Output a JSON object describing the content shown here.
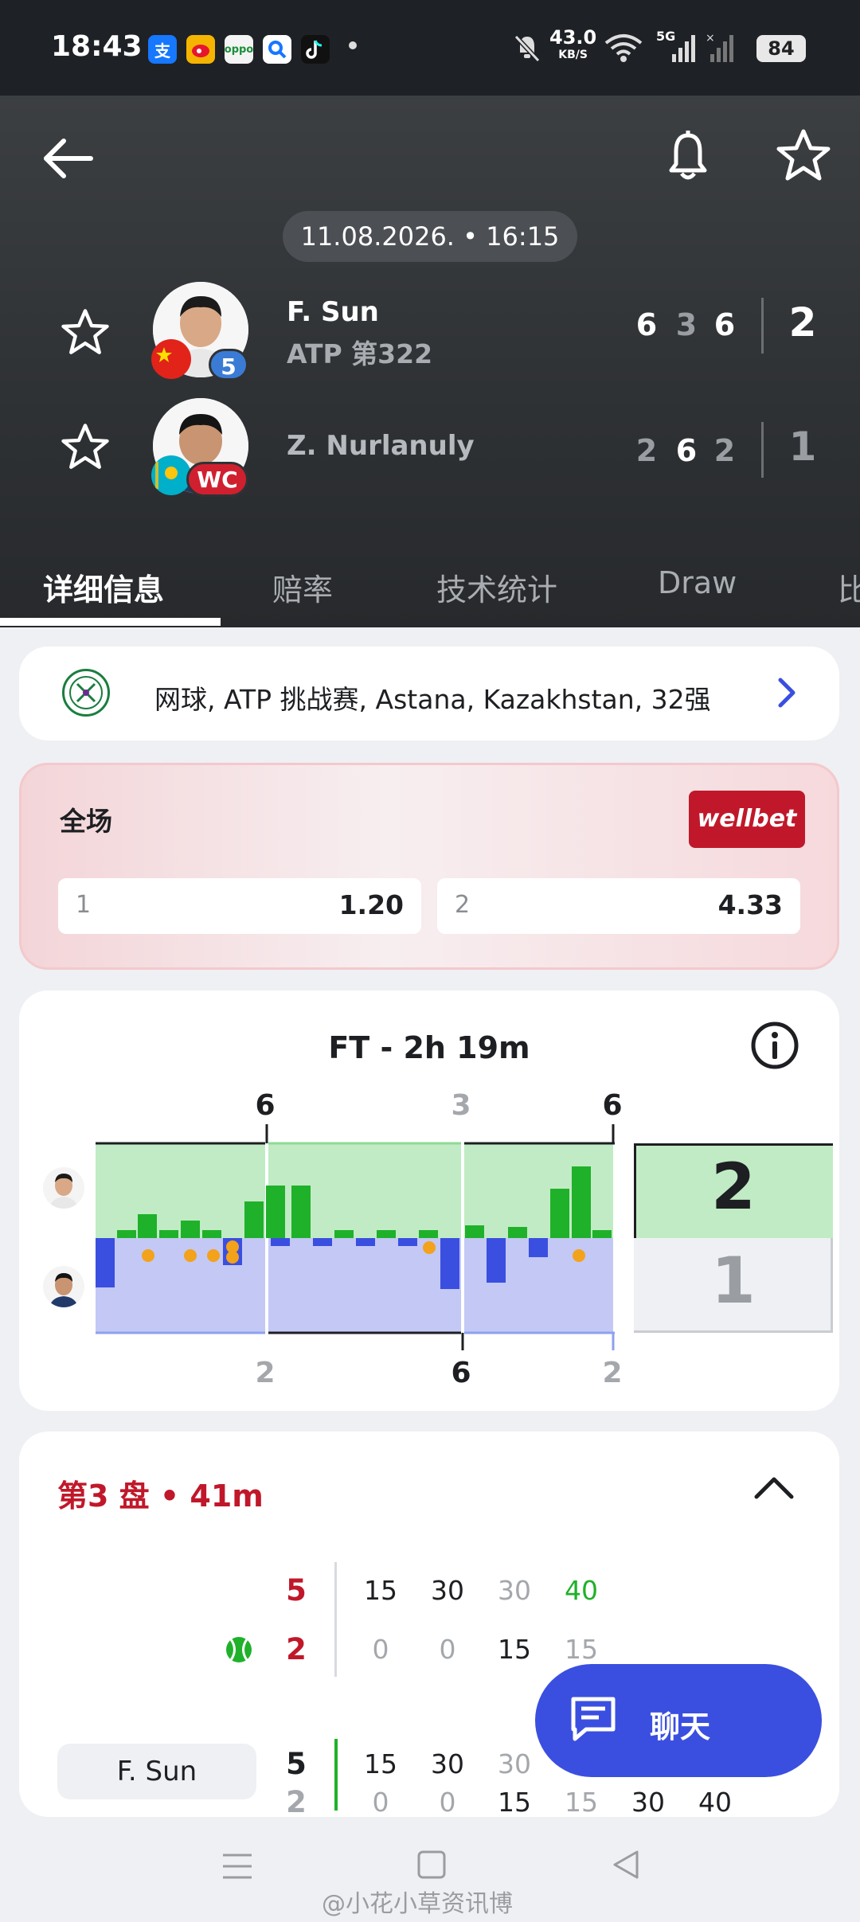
{
  "status_bar": {
    "time": "18:43",
    "net_speed_top": "43.0",
    "net_speed_unit": "KB/S",
    "signal_label": "5G",
    "battery": "84"
  },
  "header": {
    "date_time": "11.08.2026. • 16:15",
    "player1": {
      "name": "F. Sun",
      "rank": "ATP 第322",
      "seed": "5",
      "sets": [
        "6",
        "3",
        "6"
      ],
      "total": "2"
    },
    "player2": {
      "name": "Z. Nurlanuly",
      "badge": "WC",
      "sets": [
        "2",
        "6",
        "2"
      ],
      "total": "1"
    },
    "tabs": [
      "详细信息",
      "赔率",
      "技术统计",
      "Draw",
      "比"
    ]
  },
  "tournament": {
    "label": "网球, ATP 挑战赛, Astana, Kazakhstan, 32强"
  },
  "odds": {
    "title": "全场",
    "bookmaker": "wellbet",
    "options": [
      {
        "label": "1",
        "value": "1.20"
      },
      {
        "label": "2",
        "value": "4.33"
      }
    ]
  },
  "momentum": {
    "title": "FT - 2h 19m",
    "top_set_scores": [
      "6",
      "3",
      "6"
    ],
    "bottom_set_scores": [
      "2",
      "6",
      "2"
    ],
    "total_top": "2",
    "total_bottom": "1",
    "colors": {
      "player1": "#1fb12a",
      "player2": "#3a4fe0"
    }
  },
  "set3": {
    "title": "第3 盘 • 41m",
    "row1": {
      "games": "5",
      "points": [
        "15",
        "30",
        "30",
        "40"
      ]
    },
    "row2": {
      "games": "2",
      "points": [
        "0",
        "0",
        "15",
        "15"
      ]
    },
    "row3": {
      "player": "F. Sun",
      "games": "5",
      "points": [
        "15",
        "30",
        "30"
      ]
    },
    "row4": {
      "games": "2",
      "points": [
        "0",
        "0",
        "15",
        "15",
        "30",
        "40"
      ]
    }
  },
  "chat": {
    "label": "聊天"
  },
  "watermark": "@小花小草资讯博"
}
